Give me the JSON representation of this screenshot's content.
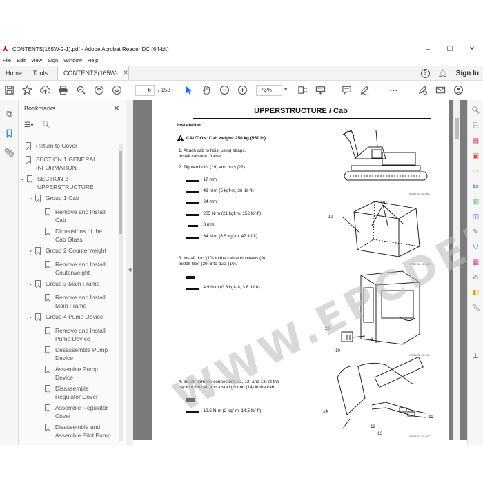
{
  "window": {
    "title": "CONTENTS(165W-2-1).pdf - Adobe Acrobat Reader DC (64-bit)",
    "minimize": "–",
    "maximize": "☐",
    "close": "✕"
  },
  "menu": [
    "File",
    "Edit",
    "View",
    "Sign",
    "Window",
    "Help"
  ],
  "tabs": {
    "home": "Home",
    "tools": "Tools",
    "doc": "CONTENTS(165W-...",
    "doc_close": "✕",
    "help": "?",
    "signin": "Sign In"
  },
  "toolbar": {
    "page_current": "6",
    "page_total": "/ 152",
    "zoom": "73%",
    "more": "···"
  },
  "bookmarks": {
    "title": "Bookmarks",
    "close": "✕",
    "items": [
      {
        "label": "Return to Cover",
        "level": 0,
        "chevron": ""
      },
      {
        "label": "SECTION 1 GENERAL INFORMATION",
        "level": 0,
        "chevron": ""
      },
      {
        "label": "SECTION 2 UPPERSTRUCTURE",
        "level": 0,
        "chevron": "⌄"
      },
      {
        "label": "Group 1 Cab",
        "level": 1,
        "chevron": "⌄"
      },
      {
        "label": "Remove and Install Cab",
        "level": 2,
        "chevron": ""
      },
      {
        "label": "Dimensions of the Cab Glass",
        "level": 2,
        "chevron": ""
      },
      {
        "label": "Group 2 Counterweight",
        "level": 1,
        "chevron": "⌄"
      },
      {
        "label": "Remove and Install Couterweight",
        "level": 2,
        "chevron": ""
      },
      {
        "label": "Group 3 Main Frame",
        "level": 1,
        "chevron": "⌄"
      },
      {
        "label": "Remove and Install Main Frame",
        "level": 2,
        "chevron": ""
      },
      {
        "label": "Group 4 Pump Device",
        "level": 1,
        "chevron": "⌄"
      },
      {
        "label": "Remove and Install Pump Device",
        "level": 2,
        "chevron": ""
      },
      {
        "label": "Desassemble Pump Device",
        "level": 2,
        "chevron": ""
      },
      {
        "label": "Assemble Pump Device",
        "level": 2,
        "chevron": ""
      },
      {
        "label": "Disassemble Regulator Cover",
        "level": 2,
        "chevron": ""
      },
      {
        "label": "Assemble Regulator Cover",
        "level": 2,
        "chevron": ""
      },
      {
        "label": "Disassemble and Assemble Pilot Pump",
        "level": 2,
        "chevron": ""
      }
    ]
  },
  "page": {
    "title": "UPPERSTRUCTURE / Cab",
    "section": "Installation",
    "caution": "CAUTION:  Cab weight: 250 kg (551 lb)",
    "step1a": "1.  Attach cab to hoist using straps.",
    "step1b": "     Install cab onto frame.",
    "step2": "2.  Tighten bolts (19) and nuts (22).",
    "t1": ": 17 mm",
    "t2": ": 49 N·m (5 kgf·m, 36 lbf·ft)",
    "t3": ": 24 mm",
    "t4": ": 205 N·m (21 kgf·m, 152 lbf·ft)",
    "t5": ": 8 mm",
    "t6": ": 64 N·m (6.5 kgf·m, 47 lbf·ft)",
    "step3a": "3.  Install duct (10) to the cab with screws (9).",
    "step3b": "     Install filter (20) into duct (10).",
    "t7": ": 4.9 N·m (0.5 kgf·m, 3.6 lbf·ft)",
    "step4a": "4.  Install harness connectors (11, 12, and 13) at the",
    "step4b": "     back of the cab and install ground (14) in the cab.",
    "t8": ": 19.5 N·m (2 kgf·m, 14.5 lbf·ft)",
    "cap1": "W157-02-01-001",
    "cap2": "W157-02-01-010",
    "cap3": "W158-02-01-001",
    "cap4": "W157-02-01-007",
    "callouts": {
      "c19": "19",
      "c22": "22",
      "c20": "20",
      "c9": "9",
      "c10": "10",
      "c11": "11",
      "c12": "12",
      "c13": "13",
      "c14": "14"
    }
  },
  "watermark": "WWW.EPCDEPOT.COM"
}
